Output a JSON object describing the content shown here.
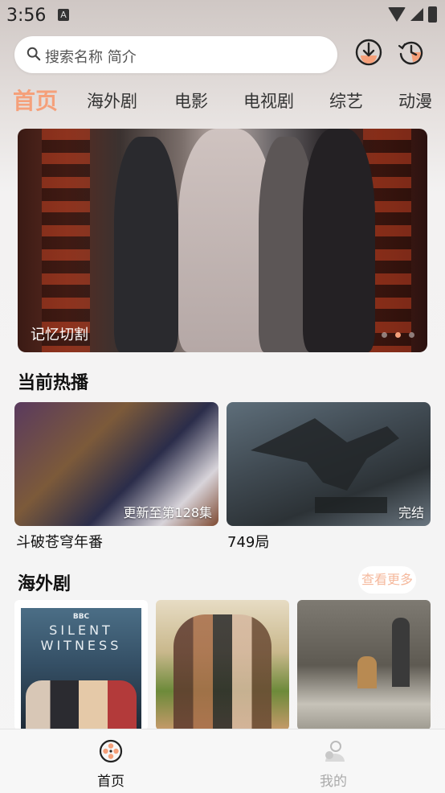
{
  "status_bar": {
    "time": "3:56",
    "notification_badge": "A"
  },
  "search": {
    "placeholder": "搜索名称 简介"
  },
  "icons": {
    "download": "download-icon",
    "history": "history-icon"
  },
  "tabs": [
    {
      "label": "首页",
      "active": true
    },
    {
      "label": "海外剧",
      "active": false
    },
    {
      "label": "电影",
      "active": false
    },
    {
      "label": "电视剧",
      "active": false
    },
    {
      "label": "综艺",
      "active": false
    },
    {
      "label": "动漫",
      "active": false
    }
  ],
  "banner": {
    "title": "记忆切割",
    "page_count": 3,
    "active_page": 2
  },
  "now_playing": {
    "title": "当前热播",
    "items": [
      {
        "name": "斗破苍穹年番",
        "badge": "更新至第128集"
      },
      {
        "name": "749局",
        "badge": "完结"
      }
    ]
  },
  "overseas": {
    "title": "海外剧",
    "more_label": "查看更多",
    "posters": [
      {
        "caption_line1": "BBC",
        "caption_line2": "SILENT",
        "caption_line3": "WITNESS"
      },
      {
        "caption_line1": ""
      },
      {
        "caption_line1": ""
      }
    ]
  },
  "bottom_nav": [
    {
      "label": "首页",
      "active": true
    },
    {
      "label": "我的",
      "active": false
    }
  ],
  "colors": {
    "accent": "#f5a07a",
    "inactive": "#aaaaaa"
  }
}
